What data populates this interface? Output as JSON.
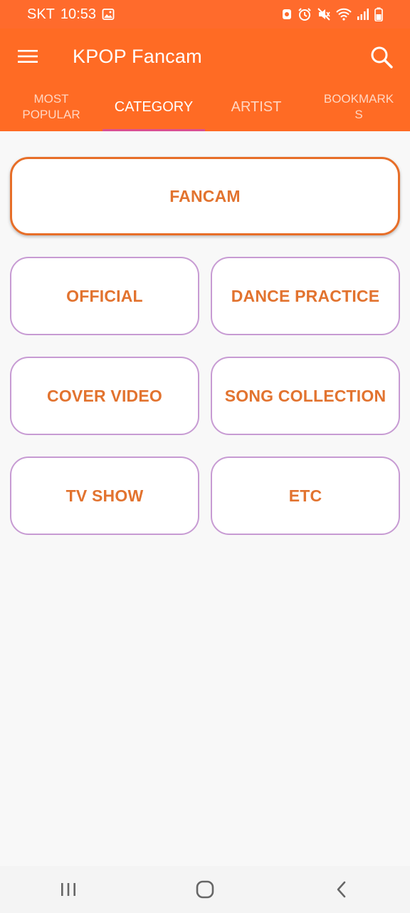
{
  "status_bar": {
    "carrier": "SKT",
    "time": "10:53",
    "icons": [
      "image-icon",
      "screen-record-icon",
      "alarm-icon",
      "mute-icon",
      "wifi-icon",
      "signal-icon",
      "battery-icon"
    ]
  },
  "app_bar": {
    "title": "KPOP Fancam",
    "menu_icon": "hamburger-menu-icon",
    "search_icon": "search-icon"
  },
  "tabs": [
    {
      "label": "MOST\nPOPULAR",
      "active": false
    },
    {
      "label": "CATEGORY",
      "active": true
    },
    {
      "label": "ARTIST",
      "active": false
    },
    {
      "label": "BOOKMARKS",
      "active": false
    }
  ],
  "categories": {
    "featured": "FANCAM",
    "items": [
      "OFFICIAL",
      "DANCE PRACTICE",
      "COVER VIDEO",
      "SONG COLLECTION",
      "TV SHOW",
      "ETC"
    ]
  },
  "nav_bar": {
    "icons": [
      "recent-apps-icon",
      "home-icon",
      "back-icon"
    ]
  },
  "colors": {
    "app_bar": "#ff6b24",
    "accent_text": "#e2732f",
    "card_border": "#c79bd3",
    "featured_border": "#e76e28",
    "tab_indicator": "#d94f93"
  }
}
